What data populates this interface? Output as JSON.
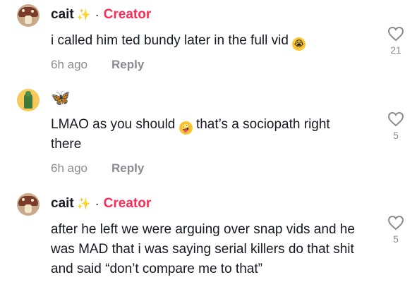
{
  "comments": [
    {
      "username": "cait",
      "badge": "Creator",
      "text": "i called him ted bundy later in the full vid",
      "emoji": "😭",
      "time": "6h ago",
      "reply_label": "Reply",
      "likes": "21"
    },
    {
      "username_icon": "butterfly-emoji",
      "text_part1": "LMAO as you should",
      "emoji": "🤪",
      "text_part2": "that’s a sociopath right there",
      "time": "6h ago",
      "reply_label": "Reply",
      "likes": "5"
    },
    {
      "username": "cait",
      "badge": "Creator",
      "text": "after he left we were arguing over snap vids and he was MAD that i was saying serial killers do that shit and said “don’t compare me to that”",
      "likes": "5"
    }
  ],
  "separator": "·",
  "colors": {
    "creator": "#fe2c55",
    "meta": "#8a8b91",
    "text": "#161823"
  }
}
